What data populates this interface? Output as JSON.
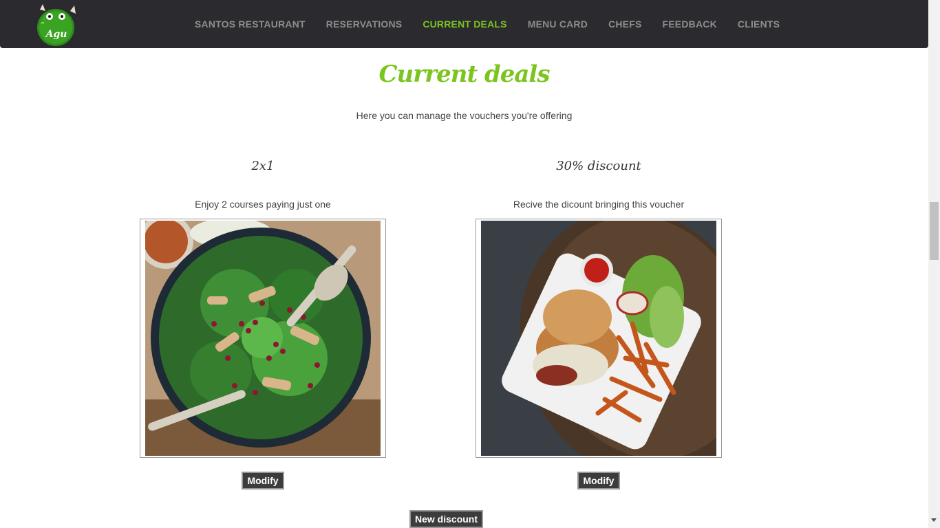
{
  "nav": {
    "items": [
      {
        "label": "SANTOS RESTAURANT",
        "active": false
      },
      {
        "label": "RESERVATIONS",
        "active": false
      },
      {
        "label": "CURRENT DEALS",
        "active": true
      },
      {
        "label": "MENU CARD",
        "active": false
      },
      {
        "label": "CHEFS",
        "active": false
      },
      {
        "label": "FEEDBACK",
        "active": false
      },
      {
        "label": "CLIENTS",
        "active": false
      }
    ],
    "accent_color": "#7cc41f"
  },
  "page": {
    "title": "Current deals",
    "subtitle": "Here you can manage the vouchers you're offering"
  },
  "deals": [
    {
      "title": "2x1",
      "description": "Enjoy 2 courses paying just one",
      "image_icon": "salad-bowl-photo",
      "button_label": "Modify"
    },
    {
      "title": "30% discount",
      "description": "Recive the dicount bringing this voucher",
      "image_icon": "burger-fries-photo",
      "button_label": "Modify"
    }
  ],
  "actions": {
    "new_discount_label": "New discount"
  }
}
